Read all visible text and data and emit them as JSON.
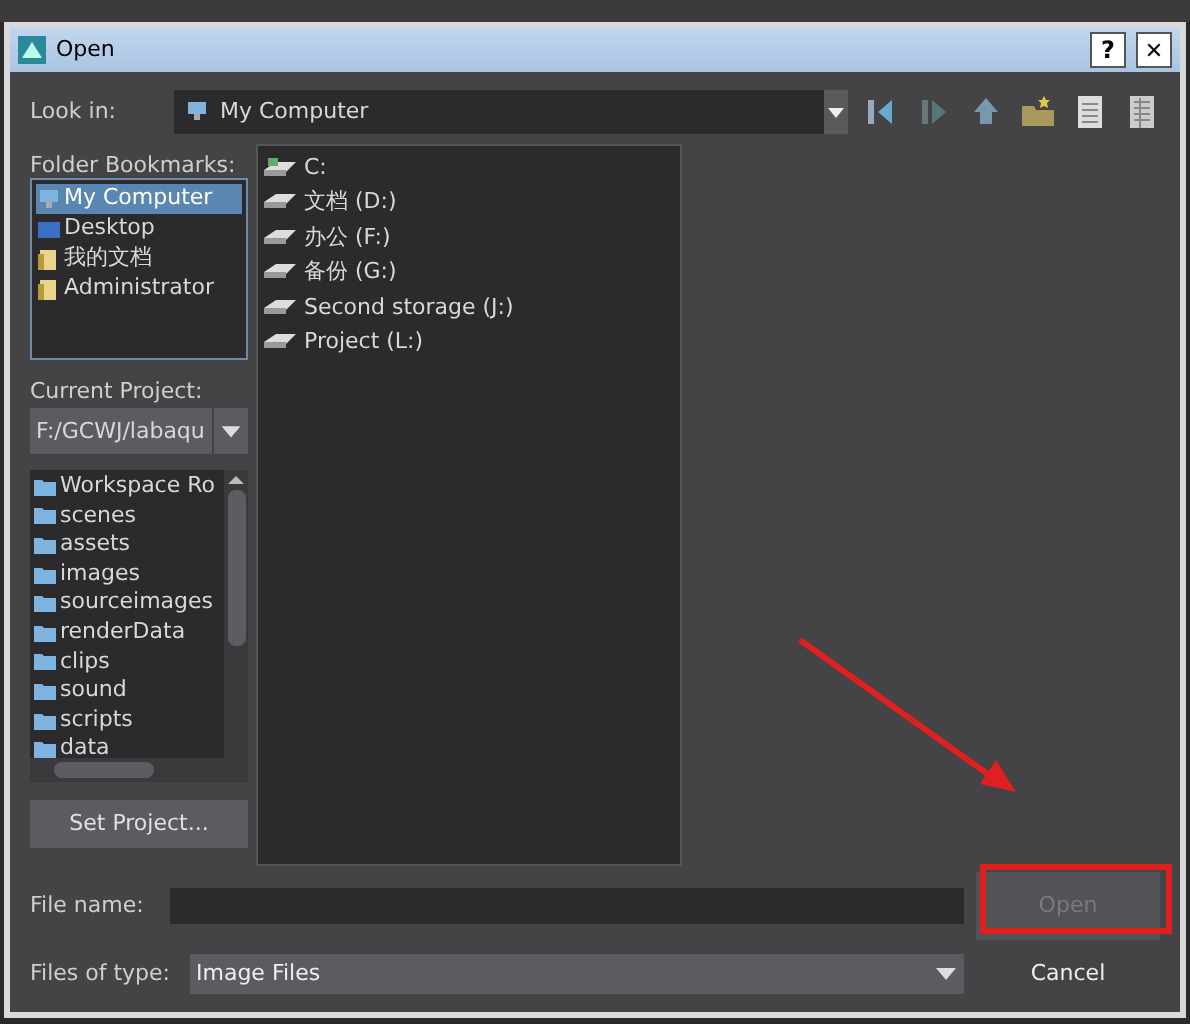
{
  "window": {
    "title": "Open",
    "help": "?",
    "close": "✕"
  },
  "look_in": {
    "label": "Look in:",
    "value": "My Computer"
  },
  "bookmarks": {
    "label": "Folder Bookmarks:",
    "items": [
      {
        "label": "My Computer",
        "selected": true,
        "kind": "computer"
      },
      {
        "label": "Desktop",
        "selected": false,
        "kind": "desktop"
      },
      {
        "label": "我的文档",
        "selected": false,
        "kind": "documents"
      },
      {
        "label": "Administrator",
        "selected": false,
        "kind": "documents"
      }
    ]
  },
  "current_project": {
    "label": "Current Project:",
    "value": "F:/GCWJ/labaqu"
  },
  "project_folders": [
    "Workspace Ro",
    "scenes",
    "assets",
    "images",
    "sourceimages",
    "renderData",
    "clips",
    "sound",
    "scripts",
    "data"
  ],
  "set_project_button": "Set Project...",
  "files": [
    {
      "label": "C:",
      "kind": "system"
    },
    {
      "label": "文档 (D:)",
      "kind": "drive"
    },
    {
      "label": "办公 (F:)",
      "kind": "drive"
    },
    {
      "label": "备份 (G:)",
      "kind": "drive"
    },
    {
      "label": "Second storage (J:)",
      "kind": "drive"
    },
    {
      "label": "Project (L:)",
      "kind": "drive"
    }
  ],
  "file_name": {
    "label": "File name:"
  },
  "file_type": {
    "label": "Files of type:",
    "value": "Image Files"
  },
  "open_button": {
    "label": "Open",
    "disabled": true
  },
  "cancel_button": {
    "label": "Cancel"
  }
}
